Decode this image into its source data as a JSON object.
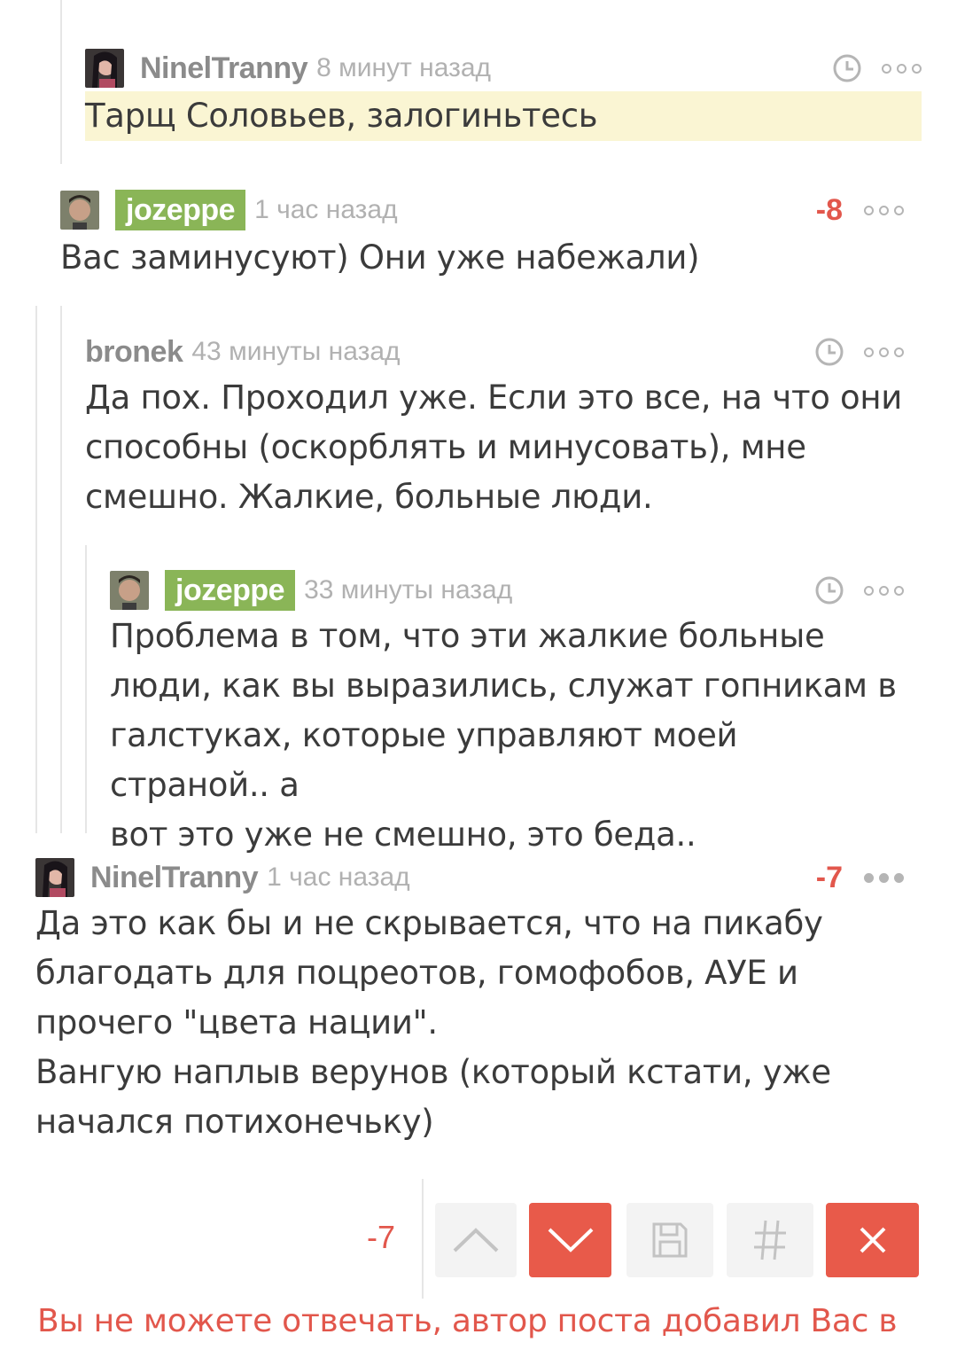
{
  "comments": [
    {
      "user": "NinelTranny",
      "time": "8 минут назад",
      "score": "",
      "text": "Тарщ Соловьев, залогиньтесь"
    },
    {
      "user": "jozeppe",
      "time": "1 час назад",
      "score": "-8",
      "text": "Вас заминусуют) Они уже набежали)"
    },
    {
      "user": "bronek",
      "time": "43 минуты назад",
      "score": "",
      "text": "Да пох. Проходил уже. Если это все, на что они\nспособны (оскорблять и минусовать), мне\nсмешно. Жалкие, больные люди."
    },
    {
      "user": "jozeppe",
      "time": "33 минуты назад",
      "score": "",
      "text": "Проблема в том, что эти жалкие больные\nлюди, как вы выразились, служат гопникам в\nгалстуках, которые управляют моей страной.. а\nвот это уже не смешно, это беда.."
    },
    {
      "user": "NinelTranny",
      "time": "1 час назад",
      "score": "-7",
      "text": "Да это как бы и не скрывается, что на пикабу\nблагодать для поцреотов, гомофобов, АУЕ и\nпрочего \"цвета нации\".\nВангую наплыв верунов (который кстати, уже\nначался потихонечьку)"
    }
  ],
  "actions": {
    "score": "-7",
    "icons": [
      "upvote-icon",
      "downvote-icon",
      "save-icon",
      "hashtag-icon",
      "close-icon"
    ]
  },
  "notice": "Вы не можете отвечать, автор поста добавил Вас в",
  "colors": {
    "accent": "#e85a4a",
    "user_highlight": "#8ab557",
    "mark_bg": "#faf5d3"
  }
}
